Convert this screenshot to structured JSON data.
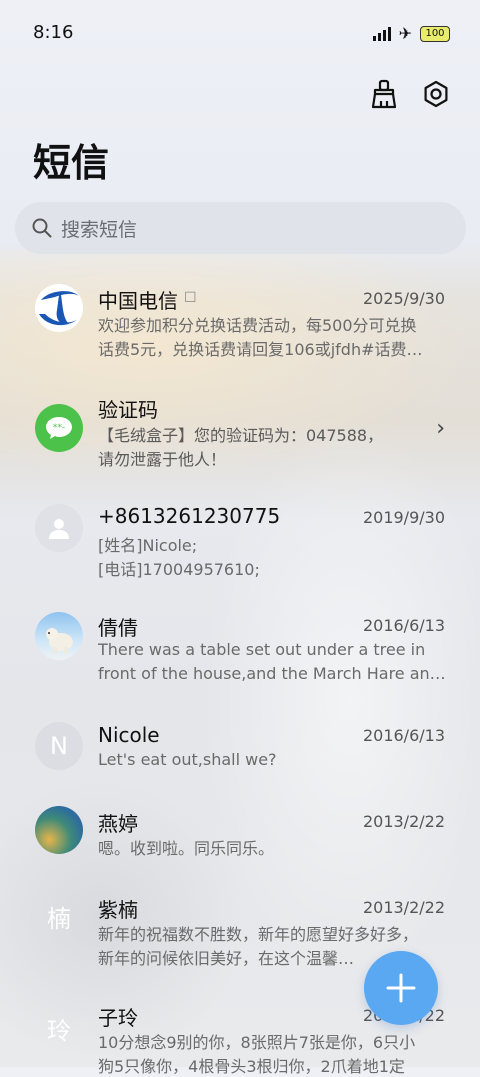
{
  "status_bar": {
    "time": "8:16",
    "battery": "100"
  },
  "header": {
    "title": "短信"
  },
  "search": {
    "placeholder": "搜索短信"
  },
  "conversations": [
    {
      "name": "中国电信",
      "date": "2025/9/30",
      "line1": "欢迎参加积分兑换话费活动，每500分可兑换",
      "line2": "话费5元，兑换话费请回复106或jfdh#话费…",
      "avatar": "china-telecom-logo"
    },
    {
      "name": "验证码",
      "date": "",
      "line1": "【毛绒盒子】您的验证码为：047588，",
      "line2": "请勿泄露于他人！",
      "avatar": "verification-code-icon"
    },
    {
      "name": "+8613261230775",
      "date": "2019/9/30",
      "line1": "[姓名]Nicole;",
      "line2": "[电话]17004957610;",
      "avatar": "default-person-icon"
    },
    {
      "name": "倩倩",
      "date": "2016/6/13",
      "line1": "There was a table set out under a tree in",
      "line2": "front of the house,and the March Hare an…",
      "avatar": "polar-bear-photo"
    },
    {
      "name": "Nicole",
      "date": "2016/6/13",
      "line1": "Let's eat out,shall we?",
      "line2": "",
      "avatar": "N"
    },
    {
      "name": "燕婷",
      "date": "2013/2/22",
      "line1": "嗯。收到啦。同乐同乐。",
      "line2": "",
      "avatar": "colorful-photo"
    },
    {
      "name": "紫楠",
      "date": "2013/2/22",
      "line1": "新年的祝福数不胜数，新年的愿望好多好多，",
      "line2": "新年的问候依旧美好，在这个温馨的时刻…",
      "avatar": "楠"
    },
    {
      "name": "子玲",
      "date": "2013/2/22",
      "line1": "10分想念9别的你，8张照片7张是你，6只小",
      "line2": "狗5只像你，4根骨头3根归你，2爪着地1定",
      "avatar": "玲"
    }
  ],
  "colors": {
    "accent": "#5aa7f2",
    "telecom_blue": "#1a56b4",
    "green": "#4cc24a"
  }
}
